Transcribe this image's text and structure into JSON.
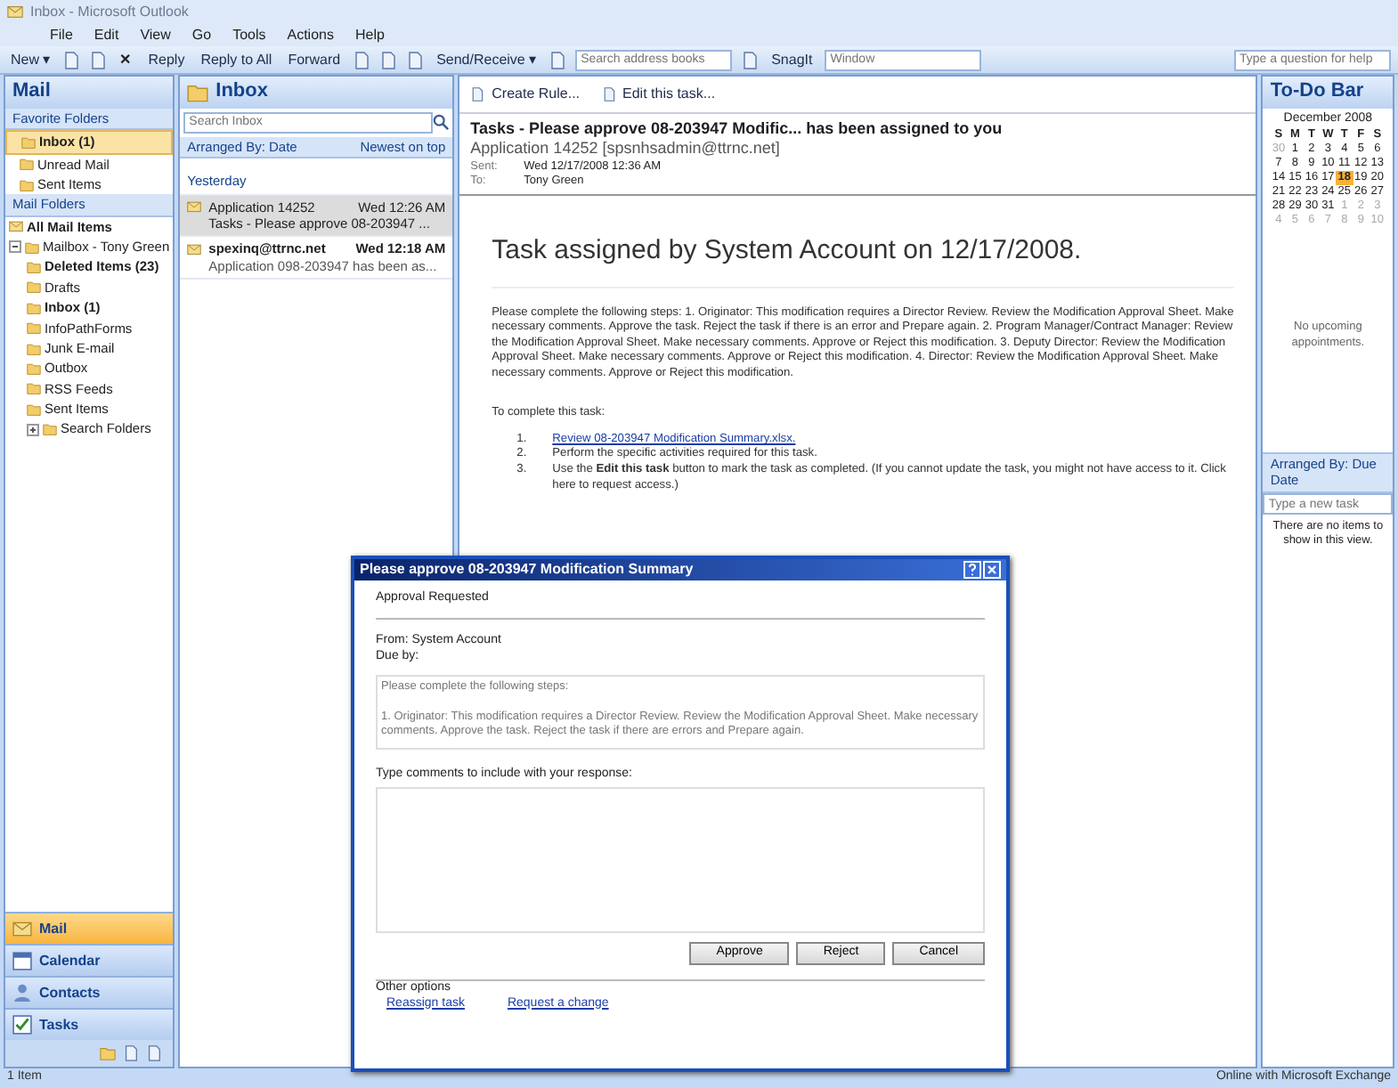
{
  "window": {
    "title": "Inbox - Microsoft Outlook"
  },
  "menu": [
    "File",
    "Edit",
    "View",
    "Go",
    "Tools",
    "Actions",
    "Help"
  ],
  "toolbar": [
    {
      "kind": "button",
      "label": "New ▾"
    },
    {
      "kind": "icon"
    },
    {
      "kind": "icon"
    },
    {
      "kind": "close",
      "label": "✕"
    },
    {
      "kind": "button",
      "label": "Reply"
    },
    {
      "kind": "button",
      "label": "Reply to All"
    },
    {
      "kind": "button",
      "label": "Forward"
    },
    {
      "kind": "icon"
    },
    {
      "kind": "icon"
    },
    {
      "kind": "icon"
    },
    {
      "kind": "button",
      "label": "Send/Receive ▾"
    },
    {
      "kind": "icon"
    },
    {
      "kind": "field",
      "placeholder": "Search address books"
    },
    {
      "kind": "icon"
    },
    {
      "kind": "button",
      "label": "SnagIt"
    },
    {
      "kind": "field",
      "placeholder": "Window"
    }
  ],
  "help_box": {
    "placeholder": "Type a question for help"
  },
  "navigation": {
    "title": "Mail",
    "favorites": {
      "title": "Favorite Folders",
      "items": [
        {
          "label": "Inbox (1)",
          "unread": true,
          "selected": true
        },
        {
          "label": "Unread Mail",
          "unread": false,
          "selected": false
        },
        {
          "label": "Sent Items",
          "unread": false,
          "selected": false
        }
      ]
    },
    "folders": {
      "title": "Mail Folders",
      "all_items": "All Mail Items",
      "tree": [
        {
          "label": "Mailbox - Tony Green",
          "unread": false,
          "expanded": true,
          "children": [
            {
              "label": "Deleted Items (23)",
              "unread": true
            },
            {
              "label": "Drafts",
              "unread": false
            },
            {
              "label": "Inbox (1)",
              "unread": true
            },
            {
              "label": "InfoPathForms",
              "unread": false
            },
            {
              "label": "Junk E-mail",
              "unread": false
            },
            {
              "label": "Outbox",
              "unread": false
            },
            {
              "label": "RSS Feeds",
              "unread": false
            },
            {
              "label": "Sent Items",
              "unread": false
            },
            {
              "label": "Search Folders",
              "unread": false,
              "expanded": false
            }
          ]
        }
      ]
    },
    "buttons": [
      {
        "label": "Mail",
        "kind": "mail",
        "selected": true
      },
      {
        "label": "Calendar",
        "kind": "calendar",
        "selected": false
      },
      {
        "label": "Contacts",
        "kind": "contacts",
        "selected": false
      },
      {
        "label": "Tasks",
        "kind": "tasks",
        "selected": false
      }
    ]
  },
  "inbox": {
    "title": "Inbox",
    "search": {
      "placeholder": "Search Inbox"
    },
    "arranged_by": "Arranged By: Date",
    "sort": "Newest on top",
    "group": "Yesterday",
    "messages": [
      {
        "sender": "Application 14252",
        "time": "Wed 12:26 AM",
        "subject": "Tasks - Please approve 08-203947 ...",
        "unread": false,
        "selected": true
      },
      {
        "sender": "spexinq@ttrnc.net",
        "time": "Wed 12:18 AM",
        "subject": "Application 098-203947 has been as...",
        "unread": true,
        "selected": false
      }
    ]
  },
  "reading_pane": {
    "actions": [
      "Create Rule...",
      "Edit this task..."
    ],
    "subject": "Tasks - Please approve 08-203947 Modific... has been assigned to you",
    "from": "Application 14252 [spsnhsadmin@ttrnc.net]",
    "sent_label": "Sent:",
    "sent": "Wed 12/17/2008 12:36 AM",
    "to_label": "To:",
    "to": "Tony Green",
    "heading": "Task assigned by System Account on 12/17/2008.",
    "body": "Please complete the following steps: 1. Originator: This modification requires a Director Review. Review the Modification Approval Sheet. Make necessary comments. Approve the task. Reject the task if there is an error and Prepare again. 2. Program Manager/Contract Manager: Review the Modification Approval Sheet. Make necessary comments. Approve or Reject this modification. 3. Deputy Director: Review the Modification Approval Sheet. Make necessary comments. Approve or Reject this modification. 4. Director: Review the Modification Approval Sheet. Make necessary comments. Approve or Reject this modification.",
    "steps_title": "To complete this task:",
    "steps": [
      {
        "number": "1.",
        "text": "Review 08-203947 Modification Summary.xlsx.",
        "kind": "link"
      },
      {
        "number": "2.",
        "text": "Perform the specific activities required for this task.",
        "kind": "text"
      },
      {
        "number": "3.",
        "text": "Use the **Edit this task** button to mark the task as completed. (If you cannot update the task, you might not have access to it. Click here to request access.)",
        "kind": "text"
      }
    ]
  },
  "todo_bar": {
    "title": "To-Do Bar",
    "calendar": {
      "month": "December 2008",
      "weekdays": [
        "S",
        "M",
        "T",
        "W",
        "T",
        "F",
        "S"
      ],
      "weeks": [
        [
          {
            "d": "30",
            "other": true,
            "today": false
          },
          {
            "d": "1",
            "other": false,
            "today": false
          },
          {
            "d": "2",
            "other": false,
            "today": false
          },
          {
            "d": "3",
            "other": false,
            "today": false
          },
          {
            "d": "4",
            "other": false,
            "today": false
          },
          {
            "d": "5",
            "other": false,
            "today": false
          },
          {
            "d": "6",
            "other": false,
            "today": false
          }
        ],
        [
          {
            "d": "7",
            "other": false,
            "today": false
          },
          {
            "d": "8",
            "other": false,
            "today": false
          },
          {
            "d": "9",
            "other": false,
            "today": false
          },
          {
            "d": "10",
            "other": false,
            "today": false
          },
          {
            "d": "11",
            "other": false,
            "today": false
          },
          {
            "d": "12",
            "other": false,
            "today": false
          },
          {
            "d": "13",
            "other": false,
            "today": false
          }
        ],
        [
          {
            "d": "14",
            "other": false,
            "today": false
          },
          {
            "d": "15",
            "other": false,
            "today": false
          },
          {
            "d": "16",
            "other": false,
            "today": false
          },
          {
            "d": "17",
            "other": false,
            "today": false
          },
          {
            "d": "18",
            "other": false,
            "today": true
          },
          {
            "d": "19",
            "other": false,
            "today": false
          },
          {
            "d": "20",
            "other": false,
            "today": false
          }
        ],
        [
          {
            "d": "21",
            "other": false,
            "today": false
          },
          {
            "d": "22",
            "other": false,
            "today": false
          },
          {
            "d": "23",
            "other": false,
            "today": false
          },
          {
            "d": "24",
            "other": false,
            "today": false
          },
          {
            "d": "25",
            "other": false,
            "today": false
          },
          {
            "d": "26",
            "other": false,
            "today": false
          },
          {
            "d": "27",
            "other": false,
            "today": false
          }
        ],
        [
          {
            "d": "28",
            "other": false,
            "today": false
          },
          {
            "d": "29",
            "other": false,
            "today": false
          },
          {
            "d": "30",
            "other": false,
            "today": false
          },
          {
            "d": "31",
            "other": false,
            "today": false
          },
          {
            "d": "1",
            "other": true,
            "today": false
          },
          {
            "d": "2",
            "other": true,
            "today": false
          },
          {
            "d": "3",
            "other": true,
            "today": false
          }
        ],
        [
          {
            "d": "4",
            "other": true,
            "today": false
          },
          {
            "d": "5",
            "other": true,
            "today": false
          },
          {
            "d": "6",
            "other": true,
            "today": false
          },
          {
            "d": "7",
            "other": true,
            "today": false
          },
          {
            "d": "8",
            "other": true,
            "today": false
          },
          {
            "d": "9",
            "other": true,
            "today": false
          },
          {
            "d": "10",
            "other": true,
            "today": false
          }
        ]
      ]
    },
    "appointments": "No upcoming appointments.",
    "tasks": {
      "arranged_by": "Arranged By: Due Date",
      "new_task": {
        "placeholder": "Type a new task"
      },
      "empty": "There are no items to show in this view."
    }
  },
  "status_bar": {
    "left": "1 Item",
    "right": "Online with Microsoft Exchange"
  },
  "dialog": {
    "title": "Please approve 08-203947 Modification Summary",
    "heading": "Approval Requested",
    "from": "From: System Account",
    "due": "Due by:",
    "details": "Please complete the following steps:\n\n1. Originator: This modification requires a Director Review. Review the Modification Approval Sheet. Make necessary comments. Approve the task. Reject the task if there are errors and Prepare again.",
    "comments_label": "Type comments to include with your response:",
    "buttons": [
      "Approve",
      "Reject",
      "Cancel"
    ],
    "other_title": "Other options",
    "other_links": [
      "Reassign task",
      "Request a change"
    ]
  }
}
